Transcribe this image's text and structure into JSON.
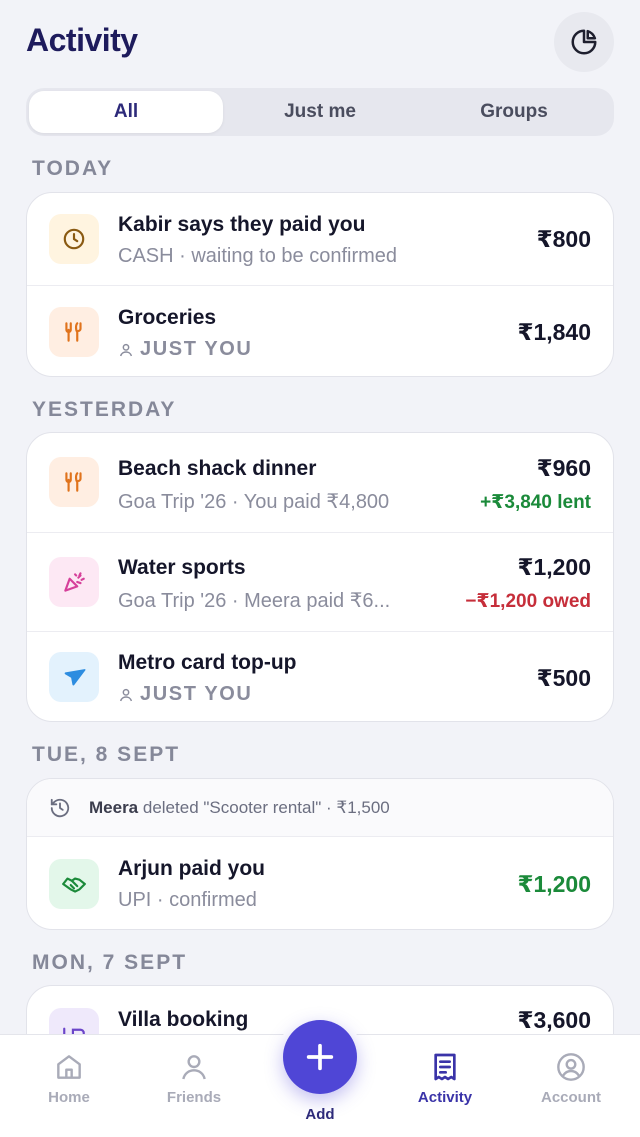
{
  "header": {
    "title": "Activity",
    "chart_icon": "pie-chart-icon"
  },
  "filter": {
    "tabs": [
      "All",
      "Just me",
      "Groups"
    ],
    "active": "All"
  },
  "sections": [
    {
      "label": "TODAY",
      "items": [
        {
          "title": "Kabir says they paid you",
          "subtitle": "CASH · waiting to be confirmed",
          "amount": "₹800",
          "icon": "clock-icon"
        },
        {
          "title": "Groceries",
          "subtitle": "JUST YOU",
          "amount": "₹1,840",
          "icon": "fork-knife-icon"
        }
      ]
    },
    {
      "label": "YESTERDAY",
      "items": [
        {
          "title": "Beach shack dinner",
          "subtitle": "Goa Trip '26 · You paid ₹4,800",
          "amount": "₹960",
          "delta": "+₹3,840 lent",
          "icon": "fork-knife-icon"
        },
        {
          "title": "Water sports",
          "subtitle": "Goa Trip '26 · Meera paid ₹6...",
          "amount": "₹1,200",
          "delta": "−₹1,200 owed",
          "icon": "party-popper-icon"
        },
        {
          "title": "Metro card top-up",
          "subtitle": "JUST YOU",
          "amount": "₹500",
          "icon": "plane-icon"
        }
      ]
    },
    {
      "label": "TUE, 8 SEPT",
      "log": {
        "actor": "Meera",
        "text": "deleted \"Scooter rental\" · ₹1,500"
      },
      "items": [
        {
          "title": "Arjun paid you",
          "subtitle": "UPI · confirmed",
          "amount": "₹1,200",
          "icon": "handshake-icon"
        }
      ]
    },
    {
      "label": "MON, 7 SEPT",
      "items": [
        {
          "title": "Villa booking",
          "amount": "₹3,600",
          "icon": "bed-icon"
        }
      ]
    }
  ],
  "tabbar": {
    "home": "Home",
    "friends": "Friends",
    "add": "Add",
    "activity": "Activity",
    "account": "Account",
    "active": "Activity"
  },
  "colors": {
    "accent": "#4f46d6",
    "lent": "#1b8a3a",
    "owed": "#c62e3a",
    "title": "#1e1b5c"
  }
}
